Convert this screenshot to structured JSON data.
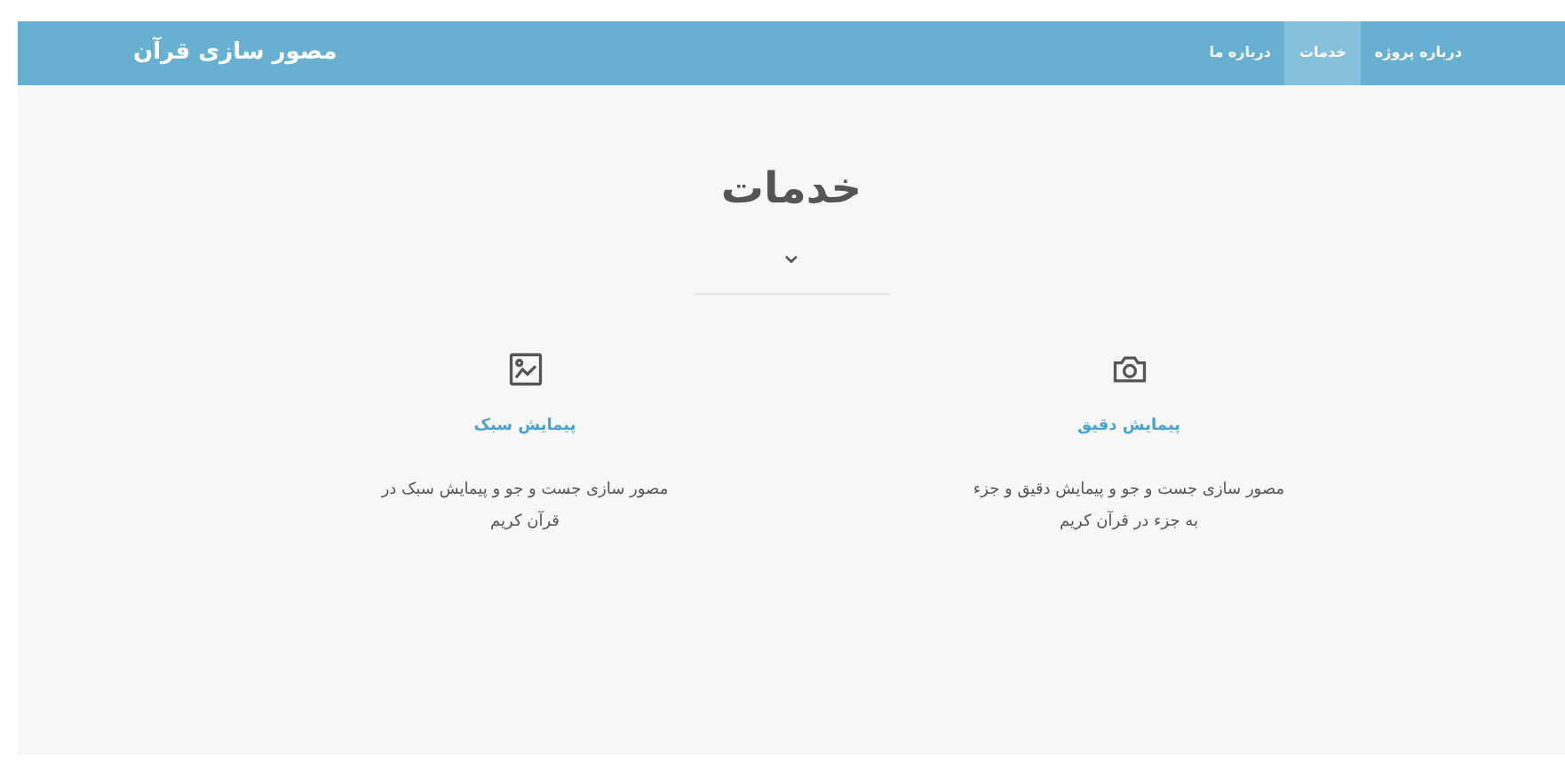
{
  "navbar": {
    "brand": "مصور سازی قرآن",
    "links": [
      {
        "label": "درباره پروژه",
        "selected": false
      },
      {
        "label": "خدمات",
        "selected": true
      },
      {
        "label": "درباره ما",
        "selected": false
      }
    ]
  },
  "section": {
    "title": "خدمات",
    "toggle": "⌄"
  },
  "services": [
    {
      "kind": "camera",
      "title": "پیمایش دقیق",
      "text": "مصور سازی جست و جو و پیمایش دقیق و جزء به جزء در قرآن کریم"
    },
    {
      "kind": "image",
      "title": "پیمایش سبک",
      "text": "مصور سازی جست و جو و پیمایش سبک در قرآن کریم"
    }
  ]
}
